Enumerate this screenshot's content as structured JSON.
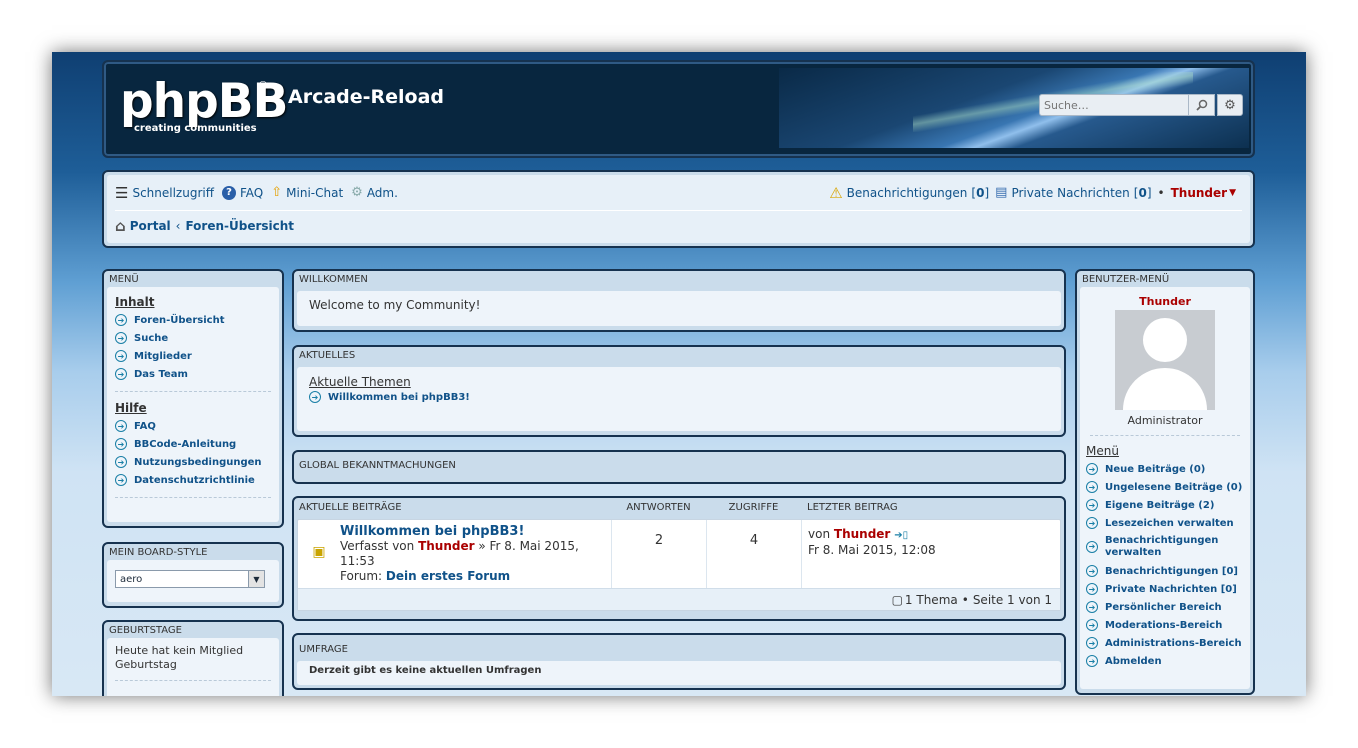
{
  "site": {
    "logo_text": "phpBB",
    "logo_tagline": "creating communities",
    "title": "Arcade-Reload"
  },
  "search": {
    "placeholder": "Suche…"
  },
  "nav": {
    "quick": "Schnellzugriff",
    "faq": "FAQ",
    "minichat": "Mini-Chat",
    "adm": "Adm.",
    "notifications_label": "Benachrichtigungen",
    "notifications_count": "0",
    "pm_label": "Private Nachrichten",
    "pm_count": "0",
    "user": "Thunder"
  },
  "breadcrumb": {
    "portal": "Portal",
    "index": "Foren-Übersicht"
  },
  "left_menu": {
    "title": "Menü",
    "content_heading": "Inhalt",
    "content_items": [
      "Foren-Übersicht",
      "Suche",
      "Mitglieder",
      "Das Team"
    ],
    "help_heading": "Hilfe",
    "help_items": [
      "FAQ",
      "BBCode-Anleitung",
      "Nutzungsbedingungen",
      "Datenschutzrichtlinie"
    ]
  },
  "style_panel": {
    "title": "Mein Board-Style",
    "selected": "aero"
  },
  "birthday_panel": {
    "title": "Geburtstage",
    "text": "Heute hat kein Mitglied Geburtstag"
  },
  "welcome": {
    "title": "Willkommen",
    "text": "Welcome to my Community!"
  },
  "news": {
    "title": "Aktuelles",
    "heading": "Aktuelle Themen",
    "item": "Willkommen bei phpBB3!"
  },
  "global": {
    "title": "Global Bekanntmachungen"
  },
  "recent": {
    "title": "Aktuelle Beiträge",
    "col_replies": "Antworten",
    "col_views": "Zugriffe",
    "col_last": "Letzter Beitrag",
    "topic_title": "Willkommen bei phpBB3!",
    "posted_prefix": "Verfasst von",
    "author": "Thunder",
    "posted_date": "» Fr 8. Mai 2015, 11:53",
    "forum_prefix": "Forum:",
    "forum": "Dein erstes Forum",
    "replies": "2",
    "views": "4",
    "last_prefix": "von",
    "last_user": "Thunder",
    "last_date": "Fr 8. Mai 2015, 12:08",
    "pager_count": "1 Thema",
    "pager_page": "Seite 1 von 1"
  },
  "poll": {
    "title": "Umfrage",
    "text": "Derzeit gibt es keine aktuellen Umfragen"
  },
  "user_menu": {
    "title": "Benutzer-Menü",
    "username": "Thunder",
    "rank": "Administrator",
    "heading": "Menü",
    "items": [
      "Neue Beiträge (0)",
      "Ungelesene Beiträge (0)",
      "Eigene Beiträge (2)",
      "Lesezeichen verwalten",
      "Benachrichtigungen verwalten",
      "Benachrichtigungen [0]",
      "Private Nachrichten [0]",
      "Persönlicher Bereich",
      "Moderations-Bereich",
      "Administrations-Bereich",
      "Abmelden"
    ]
  }
}
